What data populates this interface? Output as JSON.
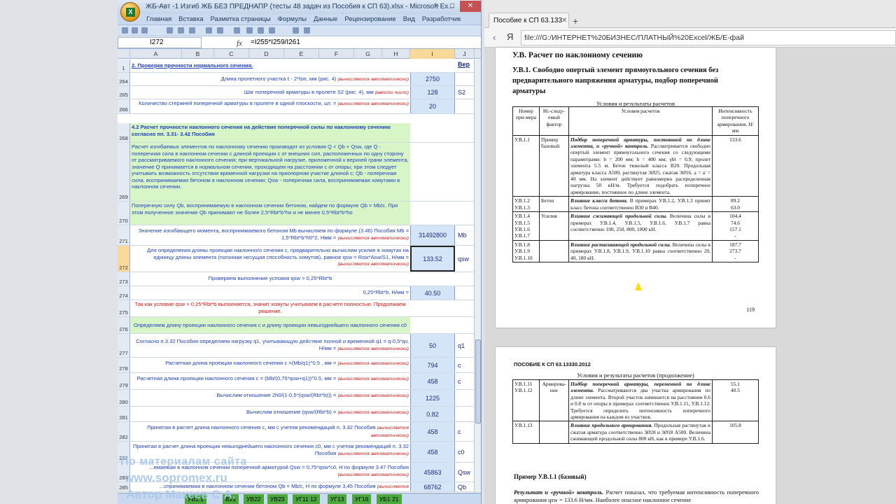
{
  "excel": {
    "title": "ЖБ-Авт -1 Изгиб ЖБ БЕЗ ПРЕДНАПР (тесты 48 задач из Пособия к СП 63).xlsx - Microsoft Ex...",
    "tabs": [
      "Главная",
      "Вставка",
      "Разметка страницы",
      "Формулы",
      "Данные",
      "Рецензирование",
      "Вид",
      "Разработчик"
    ],
    "namebox": "I272",
    "fx": "fx",
    "formula": "=I255*I259/I261",
    "columns": [
      "A",
      "B",
      "C",
      "D",
      "E",
      "F",
      "G",
      "H",
      "I",
      "J"
    ],
    "rows": [
      {
        "n": "1",
        "b": "2. Проверка прочности нормального сечения.",
        "i": "",
        "j": "Вер"
      },
      {
        "n": "264",
        "b": "Длина пролетного участка ℓ - 2*ℓоп, мм (рис. 4) ",
        "auto": "(вычисляется автоматически)",
        "i": "2750",
        "j": ""
      },
      {
        "n": "265",
        "b": "Шаг поперечной арматуры в пролете S2 (рис. 4), мм ",
        "auto": "(ввести число)",
        "i": "128",
        "j": "S2"
      },
      {
        "n": "266",
        "b": "Количество стержней поперечной арматуры в пролете в одной плоскости, шт. = ",
        "auto": "(вычисляется автоматически)",
        "i": "20",
        "j": ""
      },
      {
        "n": "268",
        "b": "4.2 Расчет прочности наклонного сечения на действие поперечной силы по наклонному сечению согласно пп. 3.31- 3.42 Пособия",
        "i": "",
        "j": ""
      },
      {
        "n": "269",
        "b": "Расчет изгибаемых элементов по наклонному сечению производят из условия Q < Qb + Qsw, где Q - поперечная сила в наклонном сечении с длиной проекции с от внешних сил, расположенных по одну сторону от рассматриваемого наклонного сечения; при вертикальной нагрузке, приложенной к верхней грани элемента, значение Q принимается в нормальном сечении, проходящем на расстоянии с от опоры; при этом следует учитывать возможность отсутствия временной нагрузки на приопорном участке длиной с; Qb - поперечная сила, воспринимаемая бетоном в наклонном сечении; Qsw - поперечная сила, воспринимаемая хомутами в наклонном сечении.",
        "i": "",
        "j": ""
      },
      {
        "n": "270",
        "b": "Поперечную силу Qb, воспринимаемую в наклонном сечении бетоном, найдем по формуле Qb = Mb/c. При этом полученное значение Qb принимают не более 2,5*Rbt*b*ho и не менее 0,5*Rbt*b*ho",
        "i": "",
        "j": ""
      },
      {
        "n": "271",
        "b": "Значение изгибающего момента, воспринимаемого бетоном Mb вычисляем по формуле (3.46) Пособия Mb = 1,5*Rbt*b*h0^2, Нмм = ",
        "auto": "(вычисляется автоматически)",
        "i": "31492800",
        "j": "Mb"
      },
      {
        "n": "272",
        "b": "Для определения длины проекции наклонного сечения с, предварительно вычислим усилие в хомутах на единицу длины элемента (погонная несущая способность хомутов), равное qsw = Rsw*Asw/S1, Н/мм = ",
        "auto": "(вычисляется автоматически)",
        "i": "133.52",
        "j": "qsw"
      },
      {
        "n": "273",
        "b": "Проверяем выполнение условия qsw > 0,25*Rbt*b",
        "i": "",
        "j": ""
      },
      {
        "n": "274",
        "b": "0,25*Rbt*b, Н/мм = ",
        "i": "40.50",
        "j": ""
      },
      {
        "n": "275",
        "b": "Так как условие qsw > 0,25*Rbt*b выполняется, значит хомуты учитываем в расчете полностью. Продолжаем решение.",
        "i": "",
        "j": ""
      },
      {
        "n": "276",
        "b": "Определяем длину проекции наклонного сечения с и длину проекции невыгоднейшего наклонного сечения с0",
        "i": "",
        "j": ""
      },
      {
        "n": "277",
        "b": "Согласно п.3.32 Пособия определяем нагрузку q1, учитывающую действие полной и временной q1 = q-0,5*qv, Н/мм = ",
        "auto": "(вычисляется автоматически)",
        "i": "50",
        "j": "q1"
      },
      {
        "n": "278",
        "b": "Расчетная длина проекции наклонного сечения c =(Mb/q1)^0.5 , мм = ",
        "auto": "(вычисляется автоматически)",
        "i": "794",
        "j": "c"
      },
      {
        "n": "279",
        "b": "Расчетная длина проекции наклонного сечения  c = (Mb/(0,75*qsw+q1))^0.5, мм = ",
        "auto": "(вычисляется автоматически)",
        "i": "458",
        "j": "c"
      },
      {
        "n": "280",
        "b": "Вычислим отношение   2h0/(1-0,5*(qsw/(Rbt*b))) = ",
        "auto": "(вычисляется автоматически)",
        "i": "1225",
        "j": ""
      },
      {
        "n": "281",
        "b": "Вычислим отношение  (qsw/(Rbt*b) = ",
        "auto": "(вычисляется автоматически)",
        "i": "0.82",
        "j": ""
      },
      {
        "n": "282",
        "b": "Принятая в расчет длина наклонного сечения c, мм с учетом рекомендаций п. 3.32 Пособия ",
        "auto": "(вычисляется автоматически)",
        "i": "458",
        "j": "c"
      },
      {
        "n": "283",
        "b": "Принятая в расчет длина проекции невыгоднейшего наклонного сечения c0, мм с учетом рекомендаций п. 3.32 Пособия ",
        "auto": "(вычисляется автоматически)",
        "i": "458",
        "j": "c0"
      },
      {
        "n": "284",
        "b": "...емаемая в наклонном сечении поперечной арматурой Qsw = 0,75*qsw*c0, Н  по формуле 3.47 Пособия ",
        "auto": "(вычисляется автоматически)",
        "i": "45863",
        "j": "Qsw"
      },
      {
        "n": "285",
        "b": "...спринимаемая в наклонном сечении бетоном Qb = Mb/c, Н  по формуле 3.45 Пособия ",
        "auto": "(вычисляется автоматически)",
        "i": "68762",
        "j": "Qb"
      }
    ],
    "sheet_tabs": [
      "УВ1.1",
      "В21",
      "УВ22",
      "УВ23",
      "УГ11 12",
      "УГ13",
      "УГ16",
      "УБ1 21"
    ],
    "watermark": [
      "По материалам сайта",
      "www.sopromex.ru",
      "Автор Макеев С.А."
    ]
  },
  "browser": {
    "tab_title": "Пособие к СП 63.133",
    "url": "file:///G:/ИНТЕРНЕТ%20БИЗНЕС/ПЛАТНЫЙ%20Excel/ЖБ/Е-фай",
    "yandex": "Я",
    "page1": {
      "heading1": "У.В. Расчет по наклонному сечению",
      "heading2": "У.В.1. Свободно опертый элемент прямоугольного сечения без предварительного напряжения арматуры, подбор поперечной арматуры",
      "caption": "Условия и результаты расчетов",
      "headers": [
        "Номер при-мера",
        "Ис-следу-емый фактор",
        "Условия расчетов",
        "Интенсивность поперечного армирования, Н/мм"
      ],
      "r1": {
        "num": "У.В.1.1",
        "factor": "Пример базовый",
        "cond_b": "Подбор поперечной арматуры, постоянной по длине элемента, и «ручной» контроль.",
        "cond": " Рассматривается свободно опертый элемент прямоугольного сечения со следующими параметрами: b = 200 мм; h = 400 мм; γbl = 0.9; пролет элемента 5.5 м. Бетон тяжелый класса В20. Продольная арматура класса А500, растянутая 3Ø25, сжатая 3Ø16, a = a' = 40 мм. На элемент действует равномерно распределенная нагрузка 50 кН/м. Требуется подобрать поперечное армирование, постоянное по длине элемента.",
        "val": "133.6"
      },
      "r2": {
        "num1": "У.В.1.2",
        "num2": "У.В.1.3",
        "factor": "Бетон",
        "cond_b": "Влияние класса бетона.",
        "cond": " В примерах У.В.1.2, У.В.1.3 принят класс бетона соответственно В30 и В40.",
        "val1": "89.2",
        "val2": "63.0"
      },
      "r3": {
        "nums": [
          "У.В.1.4",
          "У.В.1.5",
          "У.В.1.6",
          "У.В.1.7"
        ],
        "factor": "Усилия",
        "cond_b": "Влияние сжимающей продольной силы.",
        "cond": " Величина силы в примерах У.В.1.4, У.В.1.5, У.В.1.6, У.В.1.7 равна соответственно 100, 250, 800, 1000 кН.",
        "vals": [
          "104.4",
          "74.6",
          "157.1",
          "-"
        ]
      },
      "r4": {
        "nums": [
          "У.В.1.8",
          "У.В.1.9",
          "У.В.1.10"
        ],
        "cond_b": "Влияние растягивающей продольной силы.",
        "cond": " Величина силы в примерах У.В.1.8, У.В.1.9, У.В.1.10 равна соответственно 20, 40, 180 кН.",
        "vals": [
          "187.7",
          "273.7",
          "-"
        ]
      },
      "page_num": "119"
    },
    "page2": {
      "header": "ПОСОБИЕ К СП 63.13330.2012",
      "caption": "Условия и результаты расчетов (продолжение)",
      "r1": {
        "nums": [
          "У.В.1.11",
          "У.В.1.12"
        ],
        "factor": "Армирова-ние",
        "cond_b": "Подбор поперечной арматуры, переменной по длине элемента.",
        "cond": " Рассматриваются два участка армирования по длине элемента. Второй участок начинается на расстоянии 0.6 и 0.8 м от опоры в примерах соответственно У.В.1.11, У.В.1.12. Требуется определить интенсивность поперечного армирования на каждом из участков.",
        "vals": [
          "55.1",
          "40.5"
        ]
      },
      "r2": {
        "num": "У.В.1.13",
        "cond_b": "Влияние продольного армирования.",
        "cond": " Продольная растянутая и сжатая арматура соответственно 3Ø28 и 3Ø18 А500. Величина сжимающей продольной силы 800 кН, как в примере У.В.1.6.",
        "val": "105.8"
      },
      "example_title": "Пример У.В.1.1 (базовый)",
      "example_b": "Результат и «ручной» контроль.",
      "example_text": " Расчет показал, что требуемая интенсивность поперечного армирования qsw = 133.6 Н/мм. Наиболее опасное наклонное сечение"
    }
  }
}
